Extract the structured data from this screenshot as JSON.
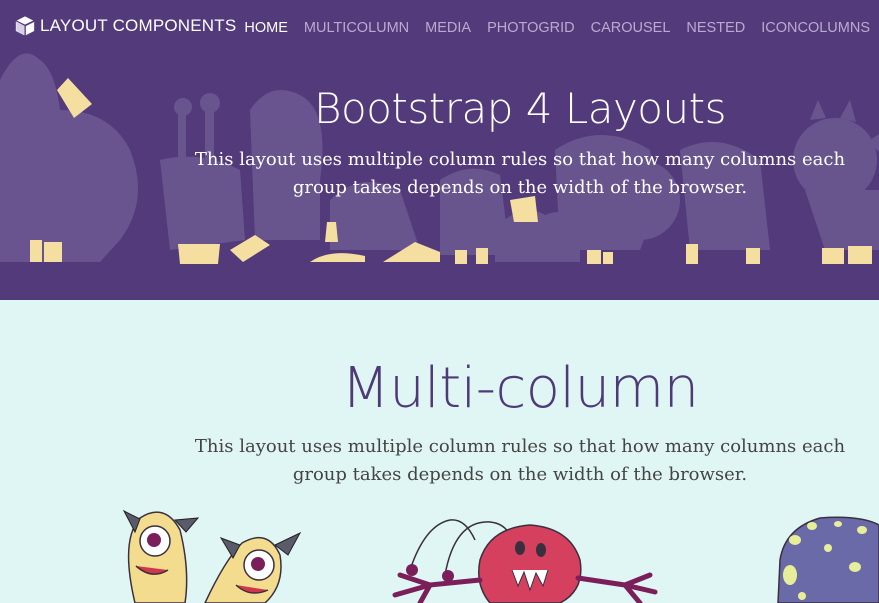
{
  "navbar": {
    "brand": {
      "icon": "cube-icon",
      "label": "LAYOUT COMPONENTS"
    },
    "items": [
      {
        "label": "HOME",
        "active": true
      },
      {
        "label": "MULTICOLUMN",
        "active": false
      },
      {
        "label": "MEDIA",
        "active": false
      },
      {
        "label": "PHOTOGRID",
        "active": false
      },
      {
        "label": "CAROUSEL",
        "active": false
      },
      {
        "label": "NESTED",
        "active": false
      },
      {
        "label": "ICONCOLUMNS",
        "active": false
      }
    ]
  },
  "hero": {
    "title": "Bootstrap 4 Layouts",
    "lead": "This layout uses multiple column rules so that how many columns each group takes depends on the width of the browser."
  },
  "section": {
    "title": "Multi-column",
    "lead": "This layout uses multiple column rules so that how many columns each group takes depends on the width of the browser."
  },
  "colors": {
    "hero_bg": "#533a7a",
    "monster_silhouette": "#6b5891",
    "monster_feet": "#f5dfa0",
    "section_bg": "#e0f6f4",
    "section_title": "#4f3a78",
    "nav_active": "#ffffff",
    "nav_inactive": "#b9abd0"
  }
}
